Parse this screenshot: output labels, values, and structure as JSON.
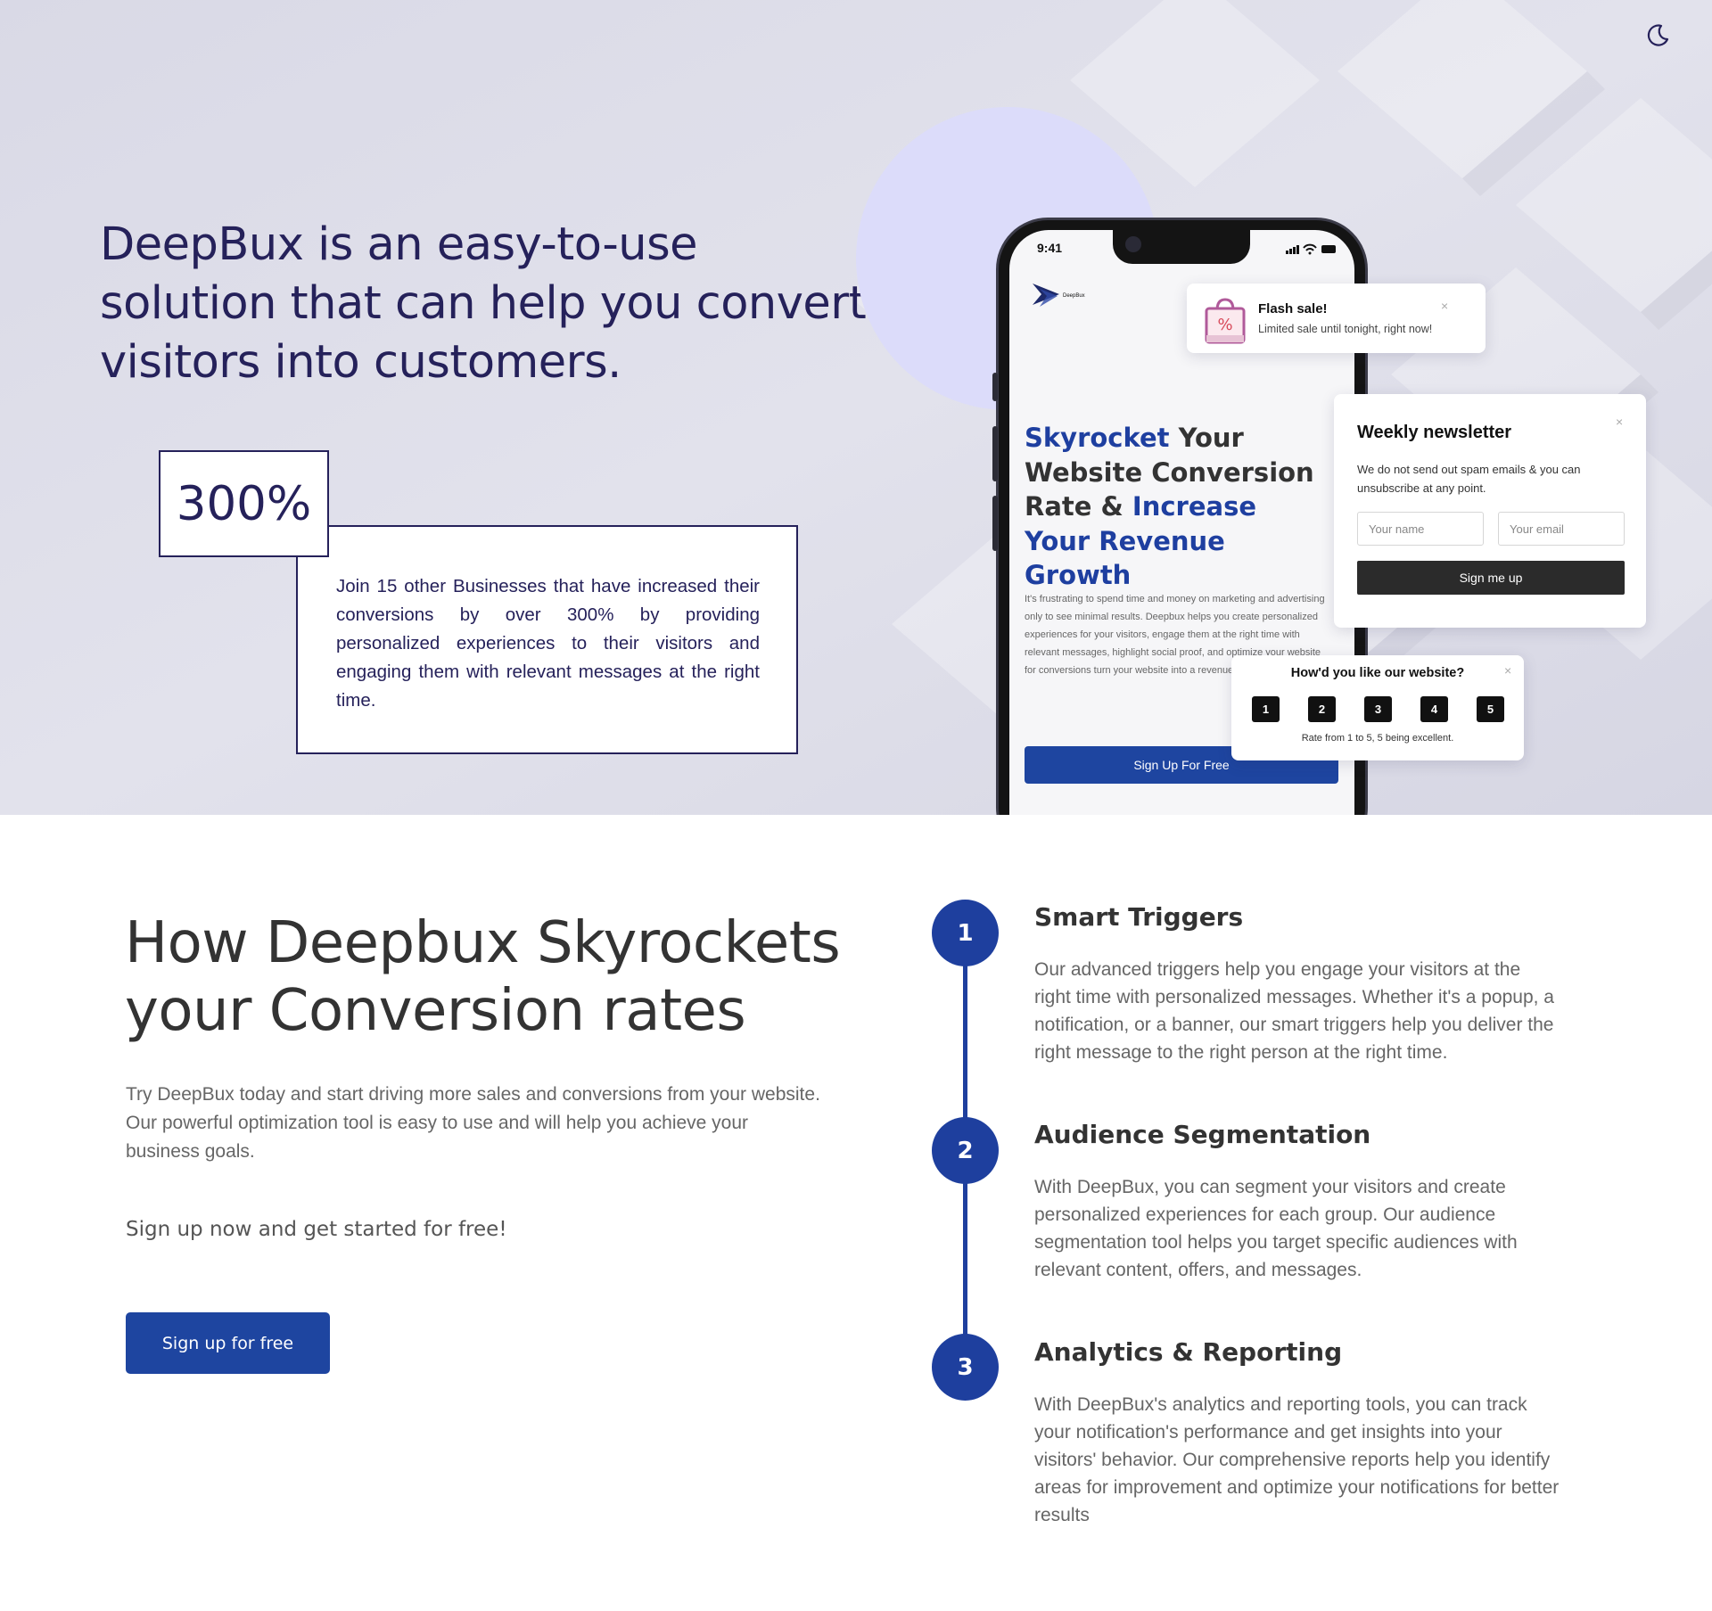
{
  "colors": {
    "primary": "#1e45a0",
    "heading_dark": "#25215a",
    "hero_bg": "#dddde8",
    "circle": "#dcdcfa",
    "step_blue": "#1e3f9e"
  },
  "header": {
    "theme_toggle_icon": "moon-icon"
  },
  "hero": {
    "title": "DeepBux is an easy-to-use solution that can help you convert visitors into customers.",
    "stat": "300%",
    "stat_text": "Join 15 other Businesses that have increased their conversions by over 300% by providing personalized experiences to their visitors and engaging them with relevant messages at the right time."
  },
  "phone": {
    "time": "9:41",
    "logo_text": "DeepBux",
    "headline": {
      "part1": "Skyrocket",
      "part2": " Your Website Conversion Rate & ",
      "part3": "Increase Your Revenue Growth"
    },
    "body": "It's frustrating to spend time and money on marketing and advertising only to see minimal results. Deepbux helps you create personalized experiences for your visitors, engage them at the right time with relevant messages, highlight social proof, and optimize your website for conversions turn your website into a revenue-generatin",
    "cta": "Sign Up For Free"
  },
  "flash_sale": {
    "icon": "shopping-bag-percent-icon",
    "title": "Flash sale!",
    "subtitle": "Limited sale until tonight, right now!",
    "close": "×"
  },
  "newsletter": {
    "title": "Weekly newsletter",
    "description": "We do not send out spam emails & you can unsubscribe at any point.",
    "name_placeholder": "Your name",
    "email_placeholder": "Your email",
    "button": "Sign me up",
    "close": "×"
  },
  "rating": {
    "question": "How'd you like our website?",
    "options": [
      "1",
      "2",
      "3",
      "4",
      "5"
    ],
    "hint": "Rate from 1 to 5, 5 being excellent.",
    "close": "×"
  },
  "how": {
    "title": "How Deepbux Skyrockets your Conversion rates",
    "description": "Try DeepBux today and start driving more sales and conversions from your website. Our powerful optimization tool is easy to use and will help you achieve your business goals.",
    "signup_text": "Sign up now and get started for free!",
    "button": "Sign up for free"
  },
  "steps": [
    {
      "number": "1",
      "title": "Smart Triggers",
      "description": "Our advanced triggers help you engage your visitors at the right time with personalized messages. Whether it's a popup, a notification, or a banner, our smart triggers help you deliver the right message to the right person at the right time."
    },
    {
      "number": "2",
      "title": "Audience Segmentation",
      "description": "With DeepBux, you can segment your visitors and create personalized experiences for each group. Our audience segmentation tool helps you target specific audiences with relevant content, offers, and messages."
    },
    {
      "number": "3",
      "title": "Analytics & Reporting",
      "description": "With DeepBux's analytics and reporting tools, you can track your notification's performance and get insights into your visitors' behavior. Our comprehensive reports help you identify areas for improvement and optimize your notifications for better results"
    }
  ]
}
